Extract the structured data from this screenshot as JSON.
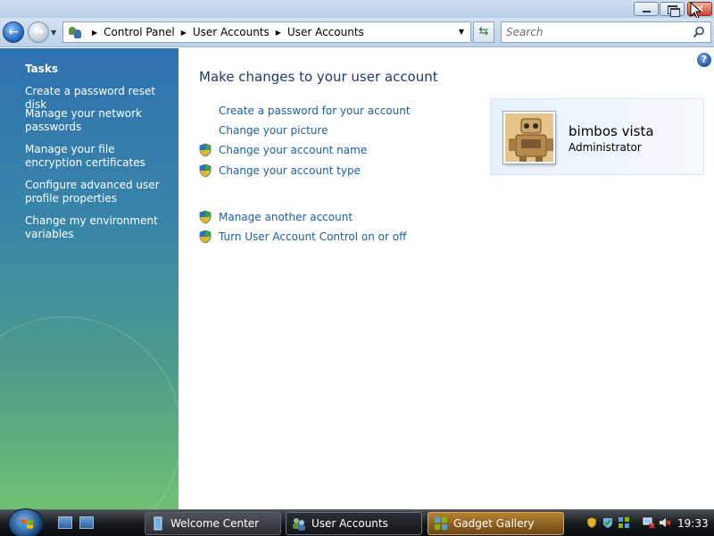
{
  "window": {
    "caption": {
      "minimize_icon": "minimize-icon",
      "maximize_icon": "restore-icon",
      "close_glyph": "✕"
    }
  },
  "address": {
    "back_glyph": "←",
    "forward_glyph": "→",
    "breadcrumb": [
      "Control Panel",
      "User Accounts",
      "User Accounts"
    ],
    "search_placeholder": "Search"
  },
  "sidebar": {
    "heading": "Tasks",
    "items": [
      {
        "label": "Create a password reset disk"
      },
      {
        "label": "Manage your network passwords"
      },
      {
        "label": "Manage your file encryption certificates"
      },
      {
        "label": "Configure advanced user profile properties"
      },
      {
        "label": "Change my environment variables"
      }
    ]
  },
  "main": {
    "help_glyph": "?",
    "title": "Make changes to your user account",
    "actions": [
      {
        "label": "Create a password for your account",
        "shield": false
      },
      {
        "label": "Change your picture",
        "shield": false
      },
      {
        "label": "Change your account name",
        "shield": true
      },
      {
        "label": "Change your account type",
        "shield": true
      },
      {
        "label": "Manage another account",
        "shield": true
      },
      {
        "label": "Turn User Account Control on or off",
        "shield": true
      }
    ]
  },
  "user": {
    "name": "bimbos vista",
    "role": "Administrator"
  },
  "taskbar": {
    "buttons": [
      {
        "label": "Welcome Center"
      },
      {
        "label": "User Accounts"
      },
      {
        "label": "Gadget Gallery"
      }
    ],
    "clock": "19:33"
  },
  "colors": {
    "link": "#1a5fa8",
    "title": "#1e3a6e",
    "sidebar_top": "#2e72b0",
    "sidebar_bottom": "#71c074"
  }
}
